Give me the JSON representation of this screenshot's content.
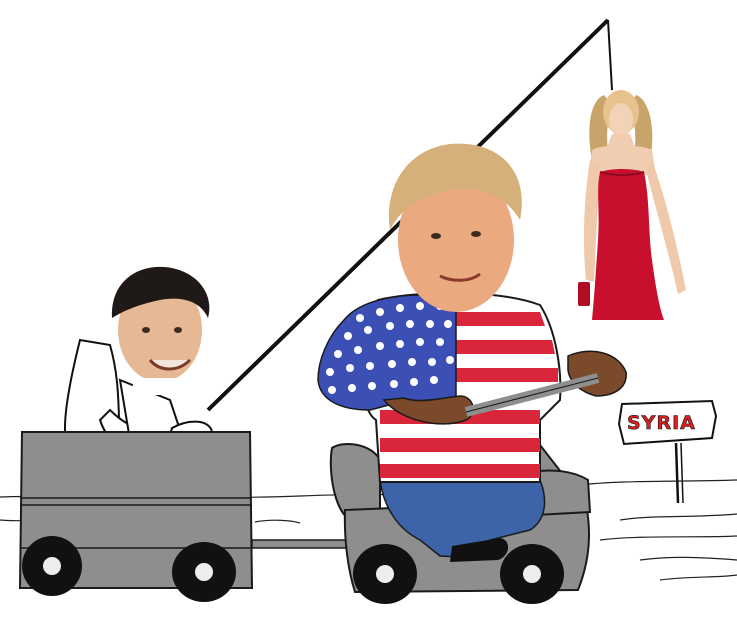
{
  "sign": {
    "label": "SYRIA"
  },
  "colors": {
    "background": "#ffffff",
    "cart_gray": "#8e8e8e",
    "outline": "#1a1a1a",
    "flag_blue": "#3b4fb5",
    "flag_red": "#d9263a",
    "skin": "#7a4a2a",
    "jeans": "#3d64a8",
    "dress_red": "#c8102e",
    "sign_text": "#d92020"
  },
  "figures": [
    {
      "name": "man-in-wagon",
      "description_icon": "person-in-cart-icon"
    },
    {
      "name": "driver",
      "description_icon": "person-driving-cart-icon"
    },
    {
      "name": "woman-in-red-dress",
      "description_icon": "person-standing-icon"
    }
  ]
}
